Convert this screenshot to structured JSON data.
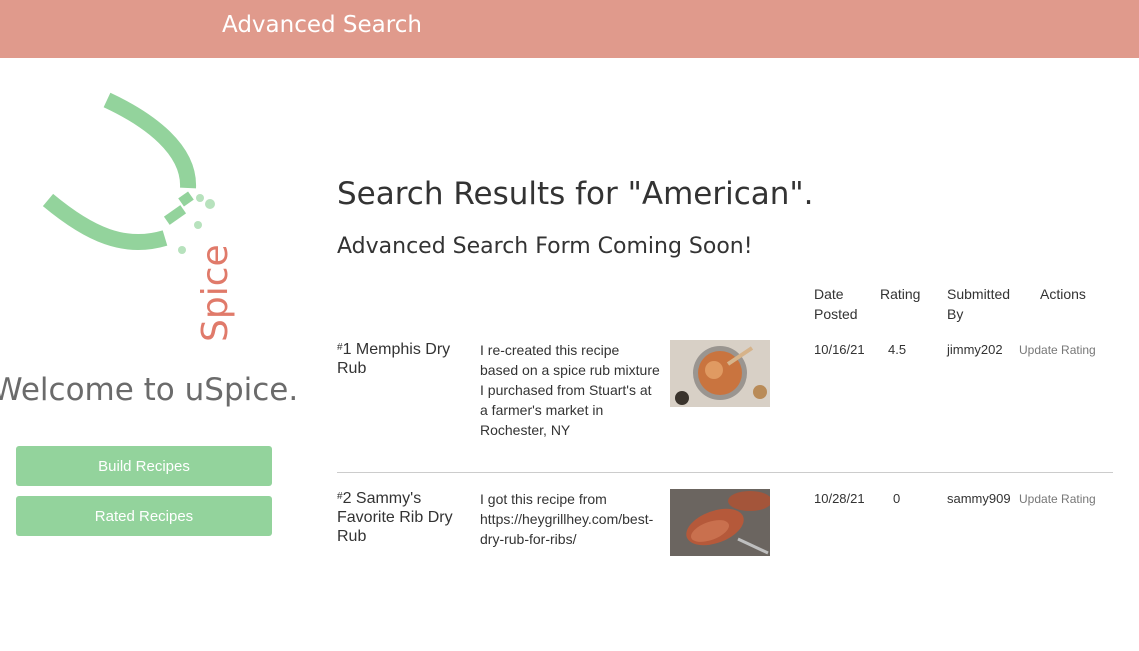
{
  "header": {
    "title": "Advanced Search"
  },
  "sidebar": {
    "logo_text": "Spice",
    "welcome": "Welcome to uSpice.",
    "buttons": [
      "Build Recipes",
      "Rated Recipes"
    ]
  },
  "main": {
    "results_heading": "Search Results for \"American\".",
    "form_notice": "Advanced Search Form Coming Soon!",
    "columns": [
      "Date Posted",
      "Rating",
      "Submitted By",
      "Actions"
    ],
    "rows": [
      {
        "rank": "#",
        "name": "1 Memphis Dry Rub",
        "description": "I re-created this recipe based on a spice rub mixture I purchased from Stuart's at a farmer's market in Rochester, NY",
        "date": "10/16/21",
        "rating": "4.5",
        "submitted_by": "jimmy202",
        "action": "Update Rating"
      },
      {
        "rank": "#",
        "name": "2 Sammy's Favorite Rib Dry Rub",
        "description": "I got this recipe from https://heygrillhey.com/best-dry-rub-for-ribs/",
        "date": "10/28/21",
        "rating": "0",
        "submitted_by": "sammy909",
        "action": "Update Rating"
      }
    ]
  },
  "colors": {
    "header": "#e09a8c",
    "accent_green": "#93d39c",
    "logo_red": "#e07a6a"
  }
}
